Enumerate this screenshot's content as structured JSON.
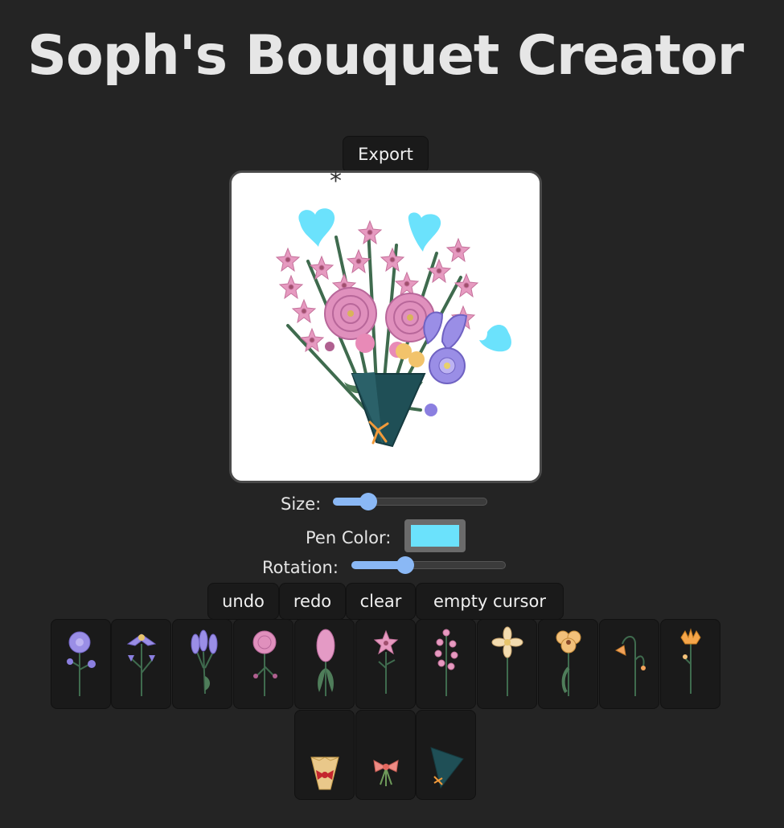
{
  "app": {
    "title": "Soph's Bouquet Creator"
  },
  "toolbar": {
    "export_label": "Export",
    "undo_label": "undo",
    "redo_label": "redo",
    "clear_label": "clear",
    "empty_cursor_label": "empty cursor"
  },
  "canvas": {
    "cursor_glyph": "*"
  },
  "controls": {
    "size_label": "Size:",
    "size_value": 0.23,
    "pen_color_label": "Pen Color:",
    "pen_color": "#6be2fc",
    "rotation_label": "Rotation:",
    "rotation_value": 0.35
  },
  "palette": {
    "flowers": [
      {
        "icon": "blue-violet-flower-icon"
      },
      {
        "icon": "purple-aster-flower-icon"
      },
      {
        "icon": "purple-tulip-bud-icon"
      },
      {
        "icon": "pink-peony-icon"
      },
      {
        "icon": "pink-hyacinth-icon"
      },
      {
        "icon": "pink-star-lily-icon"
      },
      {
        "icon": "pink-blossom-sprig-icon"
      },
      {
        "icon": "cream-daisy-icon"
      },
      {
        "icon": "peach-pansy-icon"
      },
      {
        "icon": "orange-bellflower-icon"
      },
      {
        "icon": "orange-carnation-icon"
      }
    ],
    "wrappers": [
      {
        "icon": "gold-wrap-red-bow-icon"
      },
      {
        "icon": "pink-ribbon-bundle-icon"
      },
      {
        "icon": "teal-cone-wrap-icon"
      }
    ]
  },
  "colors": {
    "background": "#242424",
    "button_bg": "#1a1a1a",
    "accent": "#8ab8f5"
  }
}
